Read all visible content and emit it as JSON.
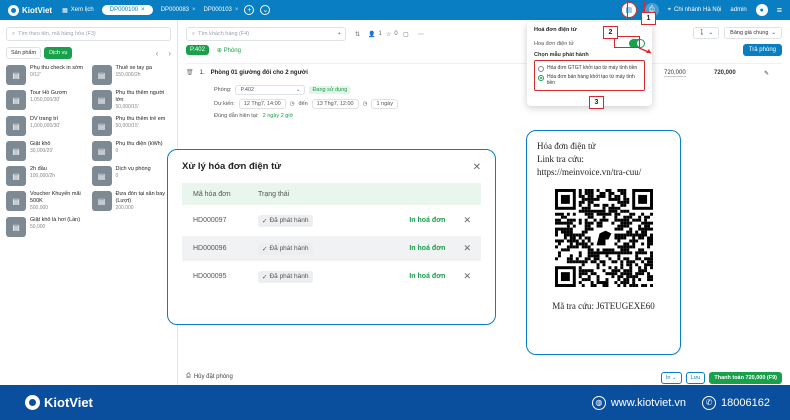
{
  "topbar": {
    "brand": "KiotViet",
    "view_room": "Xem lịch",
    "tabs": [
      "DP000100",
      "DP000083",
      "DP000103"
    ],
    "branch": "Chi nhánh Hà Nội",
    "user": "admin"
  },
  "left": {
    "search_placeholder": "Tìm theo tên, mã hàng hóa (F3)",
    "filters": [
      "Sản phẩm",
      "Dịch vụ"
    ],
    "products": [
      {
        "name": "Phụ thu check in sớm",
        "price": "0/12'"
      },
      {
        "name": "Thuê xe tay ga",
        "price": "150,000/2h"
      },
      {
        "name": "Tour Hồ Gươm",
        "price": "1,050,000/30'"
      },
      {
        "name": "Phụ thu thêm người lớn",
        "price": "50,000/15'"
      },
      {
        "name": "DV trang trí",
        "price": "1,000,000/30'"
      },
      {
        "name": "Phụ thu thêm trẻ em",
        "price": "50,000/15'"
      },
      {
        "name": "Giặt khô",
        "price": "30,000/20'"
      },
      {
        "name": "Phụ thu điện (kWh)",
        "price": "0"
      },
      {
        "name": "2h đầu",
        "price": "100,000/2h"
      },
      {
        "name": "Dịch vụ phòng",
        "price": "0"
      },
      {
        "name": "Voucher Khuyến mãi 500K",
        "price": "500,000"
      },
      {
        "name": "Đưa đón tại sân bay (Lượt)",
        "price": "200,000"
      },
      {
        "name": "Giặt khô là hơi (Lần)",
        "price": "50,000"
      }
    ],
    "cancel_label": "Hủy đặt phòng"
  },
  "main": {
    "search_placeholder": "Tìm khách hàng (F4)",
    "guests": "1",
    "children": "0",
    "room_badge": "P.402",
    "add_room": "Phòng",
    "price_list": "Bảng giá chung",
    "assign_btn": "Trả phòng",
    "line": {
      "index": "1.",
      "name": "Phòng 01 giường đôi cho 2 người",
      "room_label": "Phòng:",
      "room_value": "P.402",
      "status": "Đang sử dụng",
      "expected_label": "Dự kiến:",
      "from_date": "12 Thg7, 14:00",
      "to_label": "đến",
      "to_date": "13 Thg7, 12:00",
      "nights": "1 ngày",
      "overtime_label": "Đúng dẫn hiện tại:",
      "overtime_value": "2 ngày 2 giờ",
      "unit_price": "720,000",
      "total": "720,000"
    },
    "bottom": {
      "print": "In",
      "save": "Lưu",
      "pay": "Thanh toán 720,000 (F9)"
    }
  },
  "dropdown": {
    "title": "Hoá đơn điện tử",
    "toggle_label": "Hoa đơn điện tử",
    "choose": "Chọn mẫu phát hành",
    "option1": "Hóa đơn GTGT khởi tạo từ máy tính tiền",
    "option2": "Hóa đơn bán hàng khởi tạo từ máy tính tiền"
  },
  "callouts": [
    "1",
    "2",
    "3"
  ],
  "modal": {
    "title": "Xử lý hóa đơn điện tử",
    "col_code": "Mã hóa đơn",
    "col_status": "Trạng thái",
    "rows": [
      {
        "code": "HD000097",
        "status": "Đã phát hành",
        "action": "In hoá đơn"
      },
      {
        "code": "HD000096",
        "status": "Đã phát hành",
        "action": "In hoá đơn"
      },
      {
        "code": "HD000095",
        "status": "Đã phát hành",
        "action": "In hoá đơn"
      }
    ]
  },
  "card": {
    "line1": "Hóa đơn điện tử",
    "line2": "Link tra cứu:",
    "line3": "https://meinvoice.vn/tra-cuu/",
    "code": "Mã tra cứu: J6TEUGEXE60"
  },
  "footer": {
    "brand": "KiotViet",
    "website": "www.kiotviet.vn",
    "phone": "18006162"
  },
  "colors": {
    "primary": "#0a7ec2",
    "green": "#18a04a",
    "callout": "#d7282f",
    "footer": "#0a4f9e"
  }
}
